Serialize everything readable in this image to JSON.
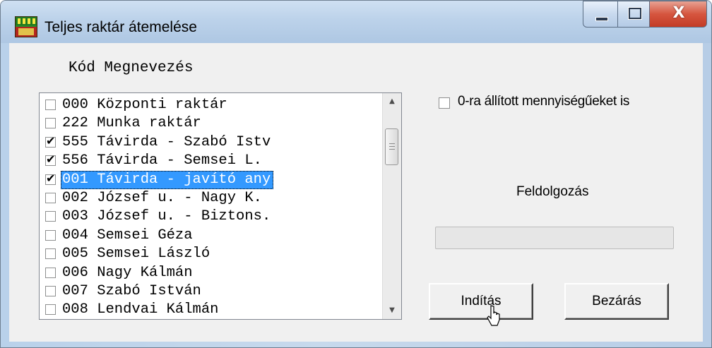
{
  "window": {
    "title": "Teljes raktár átemelése",
    "controls": {
      "minimize_icon": "minimize-icon",
      "maximize_icon": "maximize-icon",
      "close_glyph": "X"
    },
    "colors": {
      "titlebar": "#bcd2ea",
      "close_button": "#d6553f"
    }
  },
  "warehouse_list": {
    "header": "Kód Megnevezés",
    "items": [
      {
        "checked": false,
        "label": "000 Központi raktár"
      },
      {
        "checked": false,
        "label": "222 Munka raktár"
      },
      {
        "checked": true,
        "label": "555 Távirda - Szabó Istv"
      },
      {
        "checked": true,
        "label": "556 Távirda - Semsei L."
      },
      {
        "checked": true,
        "label": "001 Távirda - javító any",
        "selected": true
      },
      {
        "checked": false,
        "label": "002 József u. - Nagy K."
      },
      {
        "checked": false,
        "label": "003 József u. - Biztons."
      },
      {
        "checked": false,
        "label": "004 Semsei Géza"
      },
      {
        "checked": false,
        "label": "005 Semsei László"
      },
      {
        "checked": false,
        "label": "006 Nagy Kálmán"
      },
      {
        "checked": false,
        "label": "007 Szabó István"
      },
      {
        "checked": false,
        "label": "008 Lendvai Kálmán"
      }
    ],
    "check_glyph": "✔",
    "selection_color": "#3399ff"
  },
  "options": {
    "zero_quantity_label": "0-ra állított mennyiségűeket is",
    "zero_quantity_checked": false
  },
  "processing": {
    "label": "Feldolgozás",
    "progress": 0
  },
  "buttons": {
    "start_label": "Indítás",
    "close_label": "Bezárás"
  }
}
